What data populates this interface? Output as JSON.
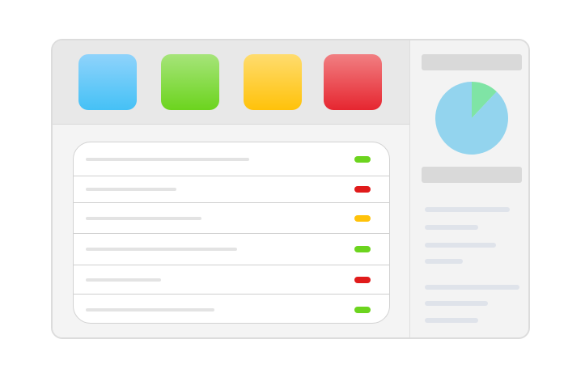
{
  "toolbar": {
    "tiles": [
      {
        "name": "blue-tile",
        "color": "#45c1f6"
      },
      {
        "name": "green-tile",
        "color": "#6cd41e"
      },
      {
        "name": "yellow-tile",
        "color": "#ffc20a"
      },
      {
        "name": "red-tile",
        "color": "#e62630"
      }
    ]
  },
  "list": {
    "rows": [
      {
        "status": "green",
        "status_color": "#6cd41e"
      },
      {
        "status": "red",
        "status_color": "#e01b1b"
      },
      {
        "status": "yellow",
        "status_color": "#ffc20a"
      },
      {
        "status": "green",
        "status_color": "#6cd41e"
      },
      {
        "status": "red",
        "status_color": "#e01b1b"
      },
      {
        "status": "green",
        "status_color": "#6cd41e"
      }
    ]
  },
  "sidebar": {
    "pie_slices": [
      {
        "label": "",
        "fraction": 0.88,
        "color": "#93d4ee"
      },
      {
        "label": "",
        "fraction": 0.12,
        "color": "#7fe4a5"
      }
    ]
  }
}
